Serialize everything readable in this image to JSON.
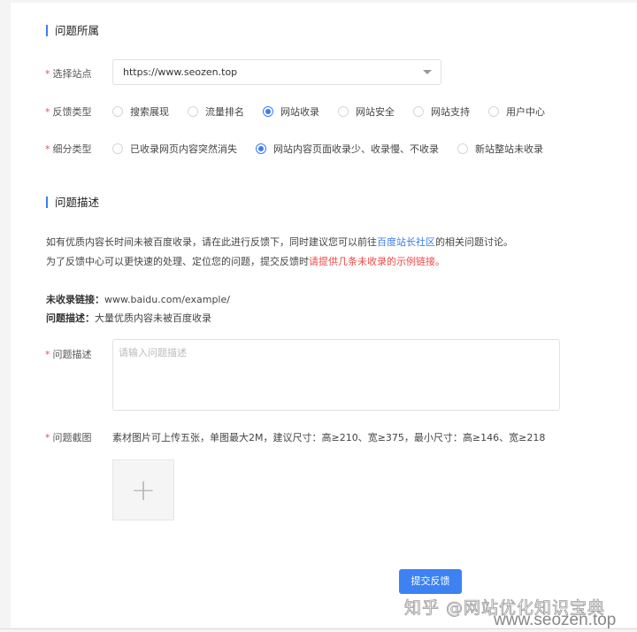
{
  "section1": {
    "title": "问题所属"
  },
  "site": {
    "label": "选择站点",
    "value": "https://www.seozen.top"
  },
  "feedback_type": {
    "label": "反馈类型",
    "options": [
      "搜索展现",
      "流量排名",
      "网站收录",
      "网站安全",
      "网站支持",
      "用户中心"
    ],
    "selected": 2
  },
  "sub_type": {
    "label": "细分类型",
    "options": [
      "已收录网页内容突然消失",
      "网站内容页面收录少、收录慢、不收录",
      "新站整站未收录"
    ],
    "selected": 1
  },
  "section2": {
    "title": "问题描述"
  },
  "intro": {
    "line1_pre": "如有优质内容长时间未被百度收录，请在此进行反馈下，同时建议您可以前往",
    "line1_link": "百度站长社区",
    "line1_post": "的相关问题讨论。",
    "line2_pre": "为了反馈中心可以更快速的处理、定位您的问题，提交反馈时",
    "line2_red": "请提供几条未收录的示例链接。"
  },
  "example": {
    "link_label": "未收录链接：",
    "link_value": "www.baidu.com/example/",
    "desc_label": "问题描述：",
    "desc_value": "大量优质内容未被百度收录"
  },
  "description": {
    "label": "问题描述",
    "placeholder": "请输入问题描述"
  },
  "screenshot": {
    "label": "问题截图",
    "hint": "素材图片可上传五张，单图最大2M，建议尺寸：高≥210、宽≥375，最小尺寸：高≥146、宽≥218",
    "upload_symbol": "+"
  },
  "submit_label": "提交反馈",
  "watermark": {
    "line1": "知乎 @网站优化知识宝典",
    "line2": "www.seozen.top"
  },
  "colors": {
    "accent": "#3d82f2",
    "required": "#f05050",
    "warning": "#f04848"
  }
}
